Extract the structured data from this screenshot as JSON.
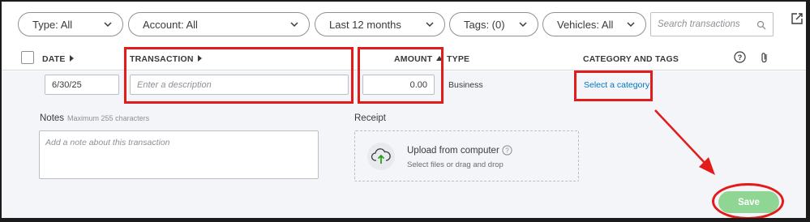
{
  "filters": {
    "type": "Type: All",
    "account": "Account: All",
    "period": "Last 12 months",
    "tags": "Tags: (0)",
    "vehicles": "Vehicles: All"
  },
  "search": {
    "placeholder": "Search transactions"
  },
  "columns": {
    "date": "DATE",
    "transaction": "TRANSACTION",
    "amount": "AMOUNT",
    "type": "TYPE",
    "category": "CATEGORY AND TAGS"
  },
  "row": {
    "date": "6/30/25",
    "description_placeholder": "Enter a description",
    "amount": "0.00",
    "type": "Business",
    "category_link": "Select a category"
  },
  "notes": {
    "label": "Notes",
    "hint": "Maximum 255 characters",
    "placeholder": "Add a note about this transaction"
  },
  "receipt": {
    "label": "Receipt",
    "title": "Upload from computer",
    "subtitle": "Select files or drag and drop"
  },
  "actions": {
    "save": "Save"
  },
  "colors": {
    "annotation": "#e21b1b",
    "save_button": "#8fd694",
    "link": "#0077c5",
    "edit_bg": "#f4f5f8",
    "upload_icon": "#2ca01c"
  }
}
